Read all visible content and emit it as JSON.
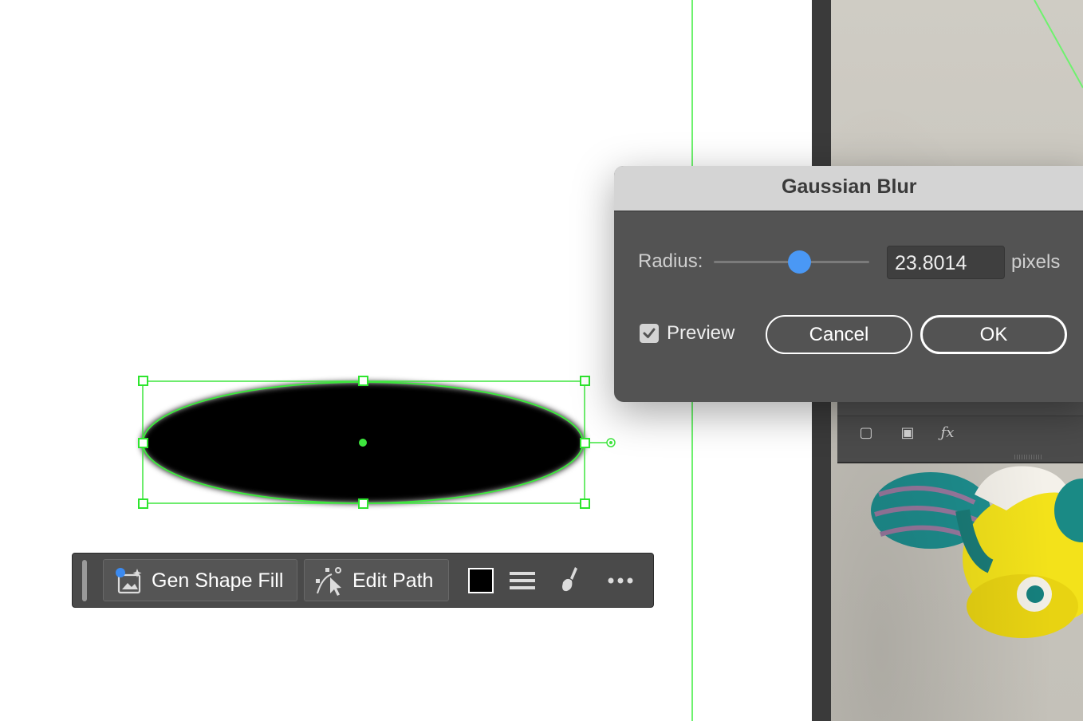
{
  "dialog": {
    "title": "Gaussian Blur",
    "radius_label": "Radius:",
    "radius_value": "23.8014",
    "radius_units": "pixels",
    "slider_level": 0.55,
    "preview_label": "Preview",
    "preview_checked": true,
    "cancel_label": "Cancel",
    "ok_label": "OK"
  },
  "toolbar": {
    "gen_shape_fill_label": "Gen Shape Fill",
    "edit_path_label": "Edit Path",
    "fill_color": "#000000",
    "icons": [
      "gen-shape-fill-icon",
      "edit-path-icon",
      "fill-swatch",
      "stroke-lines-icon",
      "brush-icon",
      "more-icon"
    ]
  },
  "colors": {
    "guide": "#6ef26e",
    "slider_accent": "#4a98f5",
    "dialog_bg": "#535353",
    "toolbar_bg": "#4a4a4a"
  }
}
